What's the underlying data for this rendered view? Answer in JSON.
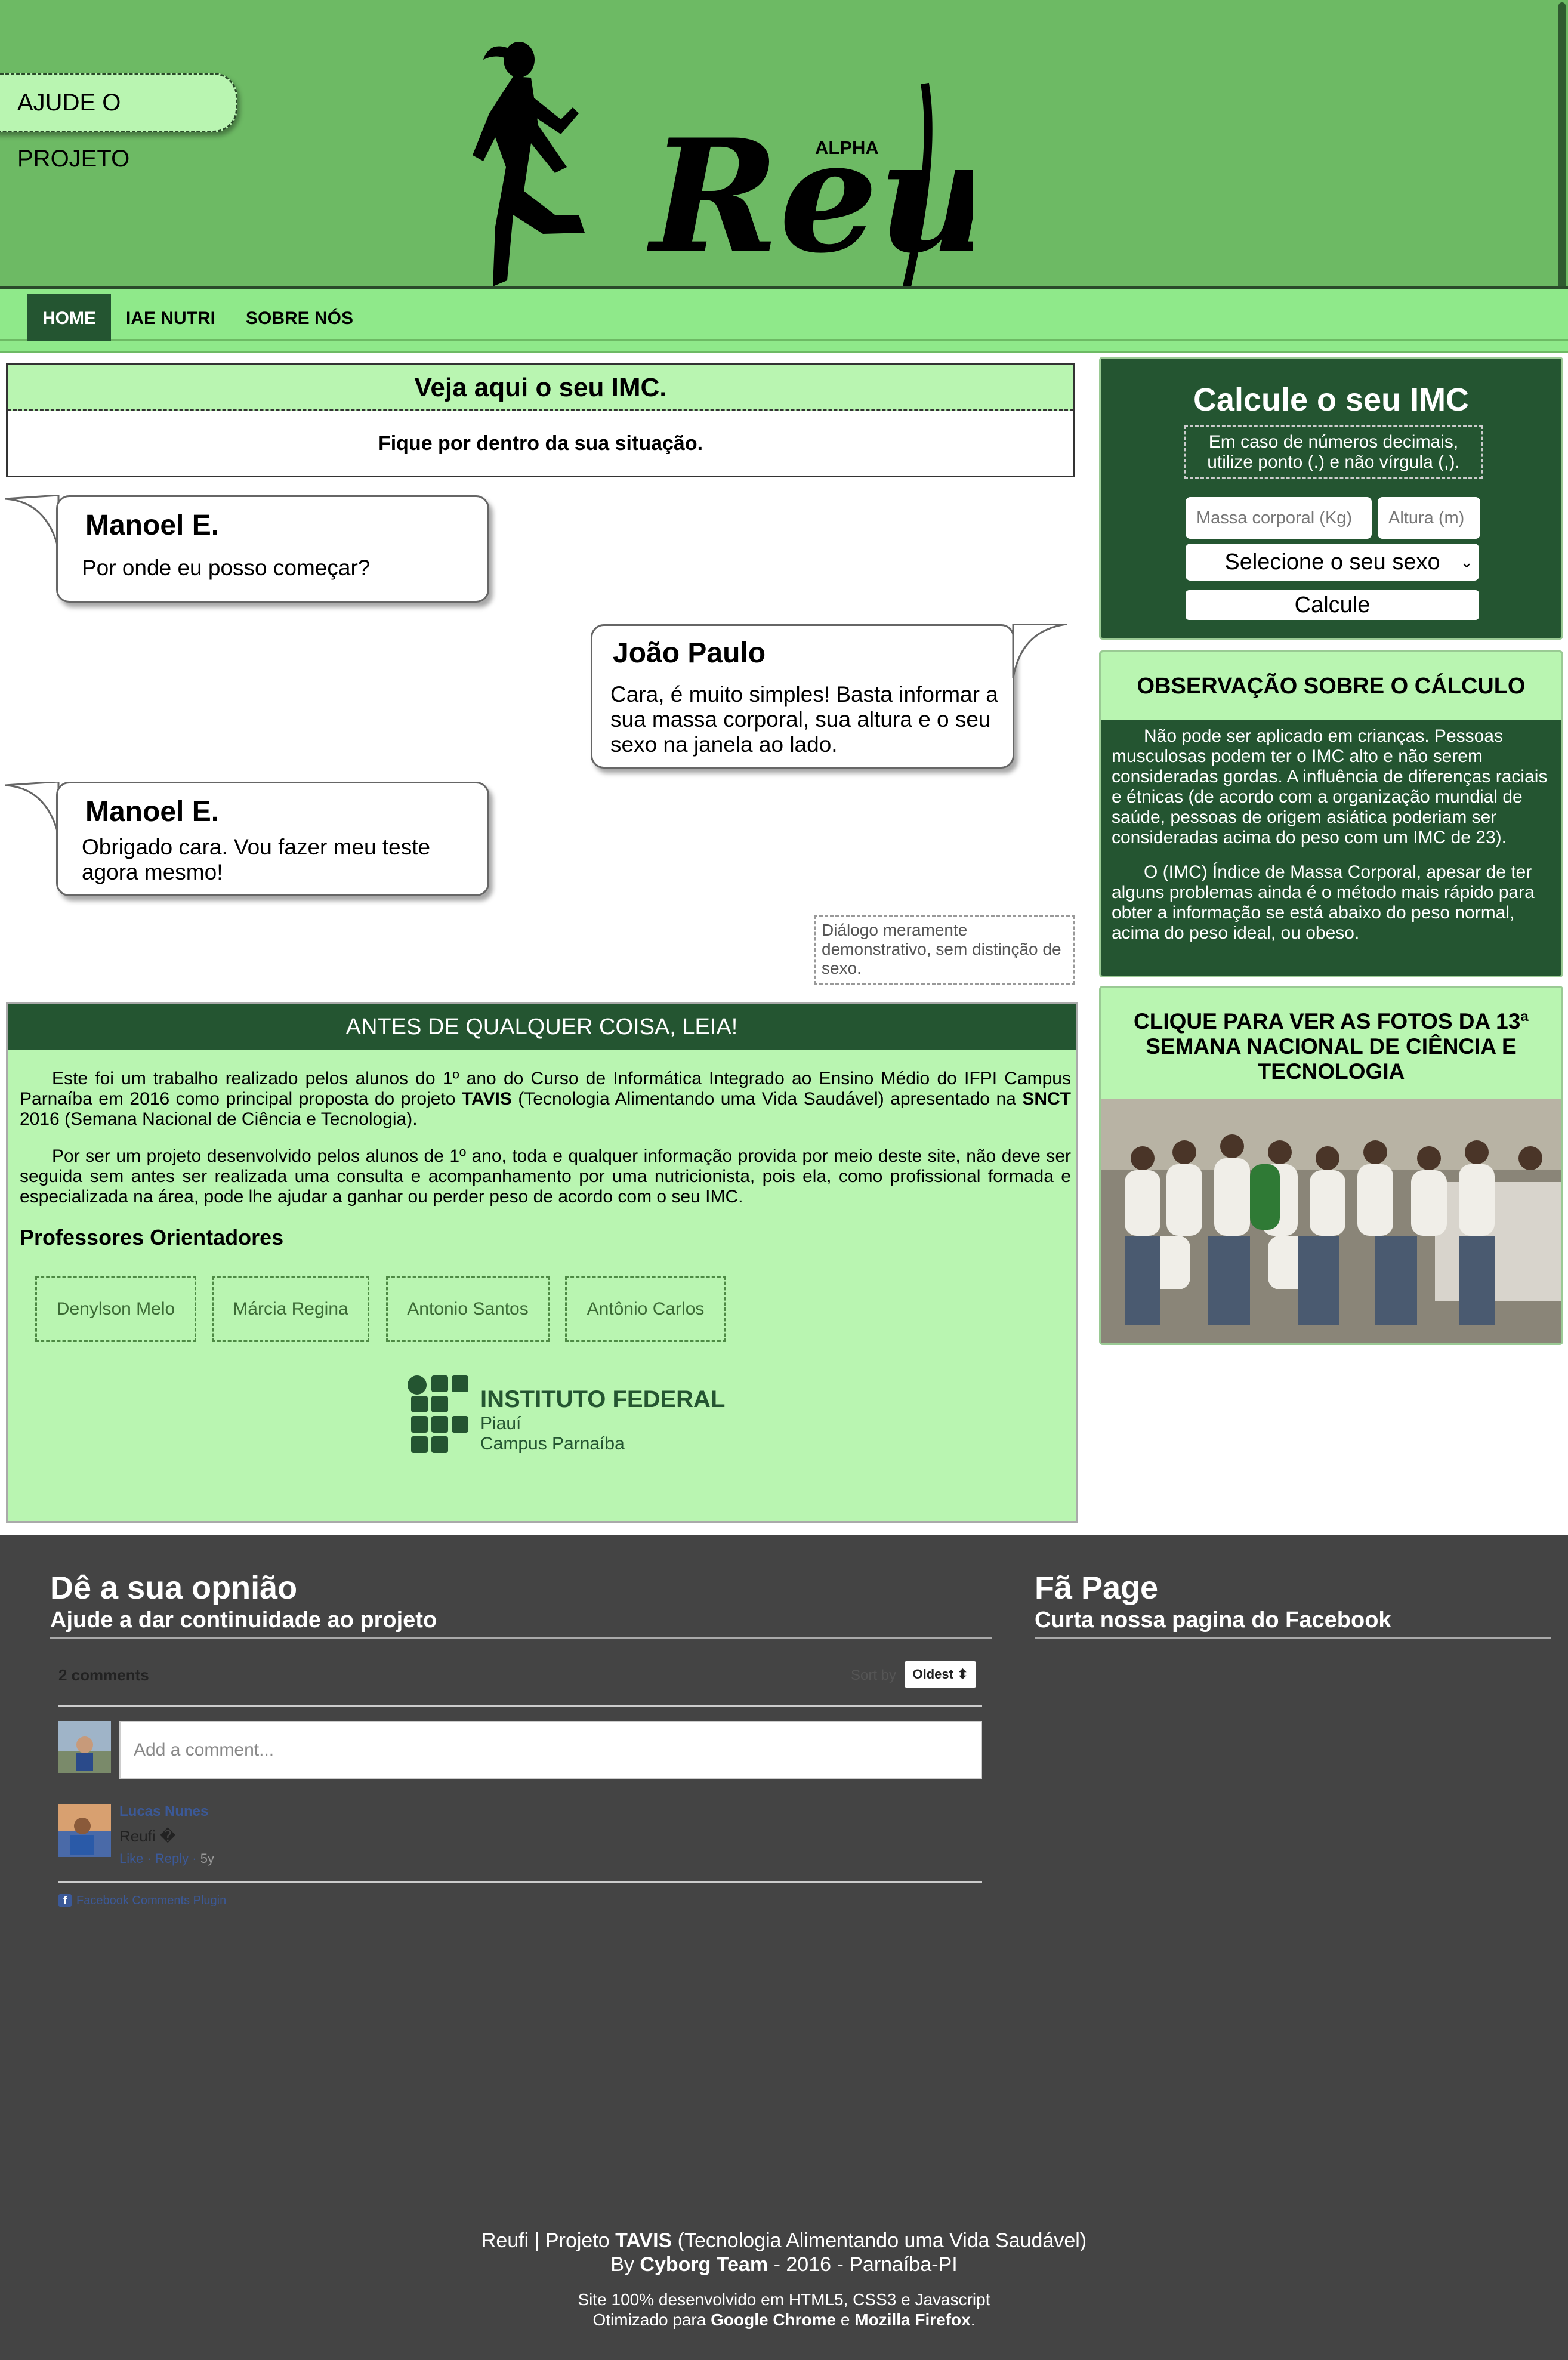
{
  "header": {
    "help_button": "AJUDE O PROJETO",
    "logo_text": "Reufi",
    "alpha": "ALPHA"
  },
  "nav": {
    "items": [
      {
        "label": "HOME",
        "active": true
      },
      {
        "label": "IAE NUTRI"
      },
      {
        "label": "SOBRE NÓS"
      }
    ]
  },
  "imc_box": {
    "title": "Veja aqui o seu IMC.",
    "subtitle": "Fique por dentro da sua situação."
  },
  "dialog": [
    {
      "name": "Manoel E.",
      "message": "Por onde eu posso começar?"
    },
    {
      "name": "João Paulo",
      "message": "Cara, é muito simples! Basta informar a sua massa corporal, sua altura e o seu sexo na janela ao lado."
    },
    {
      "name": "Manoel E.",
      "message": "Obrigado cara. Vou fazer meu teste agora mesmo!"
    }
  ],
  "dialog_note": "Diálogo meramente demonstrativo, sem distinção de sexo.",
  "read_first": {
    "title": "ANTES DE QUALQUER COISA, LEIA!",
    "p1_before_tavis": "Este foi um trabalho realizado pelos alunos do 1º ano do Curso de Informática Integrado ao Ensino Médio do IFPI Campus Parnaíba em 2016 como principal proposta do projeto ",
    "tavis": "TAVIS",
    "p1_middle": " (Tecnologia Alimentando uma Vida Saudável) apresentado na ",
    "snct": "SNCT",
    "p1_after": " 2016 (Semana Nacional de Ciência e Tecnologia).",
    "p2": "Por ser um projeto desenvolvido pelos alunos de 1º ano, toda e qualquer informação provida por meio deste site, não deve ser seguida sem antes ser realizada uma consulta e acompanhamento por uma nutricionista, pois ela, como profissional formada e especializada na área, pode lhe ajudar a ganhar ou perder peso de acordo com o seu IMC.",
    "professors_title": "Professores Orientadores",
    "professors": [
      "Denylson Melo",
      "Márcia Regina",
      "Antonio Santos",
      "Antônio Carlos"
    ],
    "institute": {
      "line1": "INSTITUTO FEDERAL",
      "line2": "Piauí",
      "line3": "Campus Parnaíba"
    }
  },
  "calculator": {
    "title": "Calcule o seu IMC",
    "note": "Em caso de números decimais, utilize ponto (.) e não vírgula (,).",
    "mass_placeholder": "Massa corporal (Kg)",
    "height_placeholder": "Altura (m)",
    "sex_select": "Selecione o seu sexo",
    "button": "Calcule"
  },
  "observation": {
    "title": "OBSERVAÇÃO SOBRE O CÁLCULO",
    "p1": "Não pode ser aplicado em crianças. Pessoas musculosas podem ter o IMC alto e não serem consideradas gordas. A influência de diferenças raciais e étnicas (de acordo com a organização mundial de saúde, pessoas de origem asiática poderiam ser consideradas acima do peso com um IMC de 23).",
    "p2": "O (IMC) Índice de Massa Corporal, apesar de ter alguns problemas ainda é o método mais rápido para obter a informação se está abaixo do peso normal, acima do peso ideal, ou obeso."
  },
  "photos": {
    "title": "CLIQUE PARA VER AS FOTOS DA 13ª SEMANA NACIONAL DE CIÊNCIA E TECNOLOGIA"
  },
  "footer": {
    "opinion_title": "Dê a sua opnião",
    "opinion_sub": "Ajude a dar continuidade ao projeto",
    "fan_title": "Fã Page",
    "fan_sub": "Curta nossa pagina do Facebook",
    "comments": {
      "count": "2 comments",
      "sort_label": "Sort by",
      "sort_value": "Oldest",
      "placeholder": "Add a comment...",
      "user": "Lucas Nunes",
      "text": "Reufi �",
      "like": "Like",
      "reply": "Reply",
      "time": "5y",
      "plugin": "Facebook Comments Plugin"
    },
    "credit_line1_a": "Reufi | Projeto ",
    "credit_line1_b": "TAVIS",
    "credit_line1_c": " (Tecnologia Alimentando uma Vida Saudável)",
    "credit_line2_a": "By ",
    "credit_line2_b": "Cyborg Team",
    "credit_line2_c": " - 2016 - Parnaíba-PI",
    "credit_line3": "Site 100% desenvolvido em HTML5, CSS3 e Javascript",
    "credit_line4_a": "Otimizado para ",
    "credit_line4_b": "Google Chrome",
    "credit_line4_c": " e ",
    "credit_line4_d": "Mozilla Firefox",
    "credit_line4_e": "."
  },
  "colors": {
    "header_green": "#6dba64",
    "nav_green": "#8fe98a",
    "dark_green": "#245531",
    "light_green": "#b9f5b1",
    "footer_gray": "#444444"
  }
}
